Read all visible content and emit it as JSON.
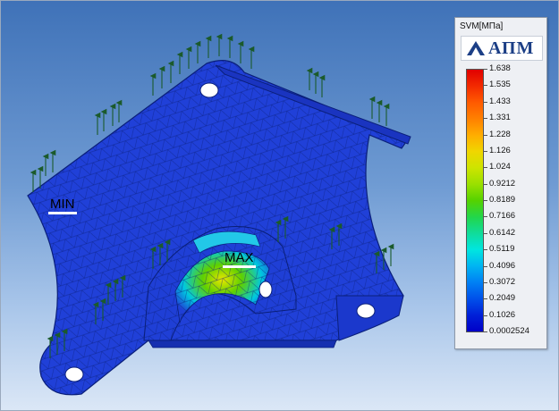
{
  "legend": {
    "title": "SVM[МПа]",
    "logo_text": "АПМ",
    "ticks": [
      "1.638",
      "1.535",
      "1.433",
      "1.331",
      "1.228",
      "1.126",
      "1.024",
      "0.9212",
      "0.8189",
      "0.7166",
      "0.6142",
      "0.5119",
      "0.4096",
      "0.3072",
      "0.2049",
      "0.1026",
      "0.0002524"
    ],
    "colors": {
      "max": "#e00000",
      "min": "#0000c8"
    }
  },
  "markers": {
    "min_label": "MIN",
    "max_label": "MAX"
  },
  "colors": {
    "model_base": "#1f3fd6",
    "mesh_line": "#0a1f7a",
    "load_arrow": "#1b5a2b",
    "background_top": "#3f72b8",
    "background_bottom": "#dbe7f6"
  }
}
